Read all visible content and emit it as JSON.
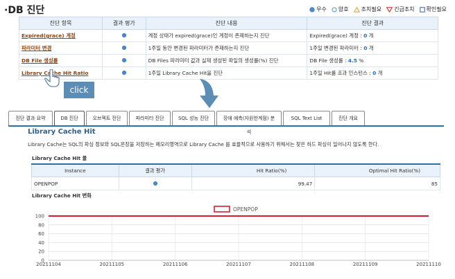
{
  "page_title": "DB 진단",
  "legend": {
    "items": [
      {
        "label": "우수",
        "icon": "filled-circle-icon",
        "color": "#4a8fd0"
      },
      {
        "label": "양호",
        "icon": "hollow-circle-icon",
        "color": "#4a8fd0"
      },
      {
        "label": "조치필요",
        "icon": "hollow-triangle-icon",
        "color": "#e0a020"
      },
      {
        "label": "긴급조치",
        "icon": "hollow-inverted-triangle-icon",
        "color": "#e02020"
      },
      {
        "label": "확인필요",
        "icon": "hollow-square-icon",
        "color": "#3060a0"
      }
    ]
  },
  "top_table": {
    "headers": [
      "진단 항목",
      "결과 평가",
      "진단 내용",
      "진단 결과"
    ],
    "rows": [
      {
        "item": "Expired(grace) 계정",
        "content": "계정 상태가 expired(grace)인 계정이 존재하는지 진단",
        "result_prefix": "Expired(grace) 계정 : ",
        "result_value": "0",
        "result_suffix": " 개"
      },
      {
        "item": "파라미터 변경",
        "content": "1주일 동안 변경된 파라미터가 존재하는지 진단",
        "result_prefix": "1주일 변경된 파라미터 : ",
        "result_value": "0",
        "result_suffix": " 개"
      },
      {
        "item": "DB File 생성률",
        "content": "DB Files 파라미터 값과 실제 생성된 파일의 생성률(%) 진단",
        "result_prefix": "DB File 생성률 : ",
        "result_value": "4.5",
        "result_suffix": " %"
      },
      {
        "item": "Library Cache Hit Ratio",
        "content": "1주일 Library Cache Hit을 진단",
        "result_prefix": "1주일 Hit률 조과 인스턴스 : ",
        "result_value": "0",
        "result_suffix": " 개"
      }
    ]
  },
  "click_label": "click",
  "tabs": [
    "진단 결과 요약",
    "DB 진단",
    "오브젝트 진단",
    "파라미터 진단",
    "SQL 성능 진단",
    "장애 예측(자원한계점) 분석",
    "SQL Text List",
    "진단 개요"
  ],
  "active_tab_index": 1,
  "section": {
    "title": "Library Cache Hit",
    "description": "Library Cache는 SQL의 파싱 정보와 SQL문장을 저장하는 메모리영역으로 Library Cache 를 효율적으로 사용하기 위해서는 잦은 하드 파싱이 일어나지 않도록 한다.",
    "ratio_title": "Library Cache Hit 율",
    "ratio_table": {
      "headers": [
        "Instance",
        "결과 평가",
        "Hit Ratio(%)",
        "Optimal Hit Ratio(%)"
      ],
      "rows": [
        {
          "instance": "OPENPOP",
          "hit_ratio": "99.47",
          "optimal": "85"
        }
      ]
    },
    "trend_title": "Library Cache Hit 변화"
  },
  "chart_data": {
    "type": "line",
    "series": [
      {
        "name": "OPENPOP",
        "color": "#e0192f",
        "values": [
          100,
          100,
          100,
          100,
          100,
          100,
          100
        ]
      }
    ],
    "x": [
      "20211104",
      "20211105",
      "20211106",
      "20211107",
      "20211108",
      "20211109",
      "20211110"
    ],
    "ylim": [
      0,
      100
    ],
    "yticks": [
      "100",
      "80",
      "60",
      "40",
      "20",
      "0"
    ],
    "grid": true,
    "legend_position": "top-center"
  }
}
